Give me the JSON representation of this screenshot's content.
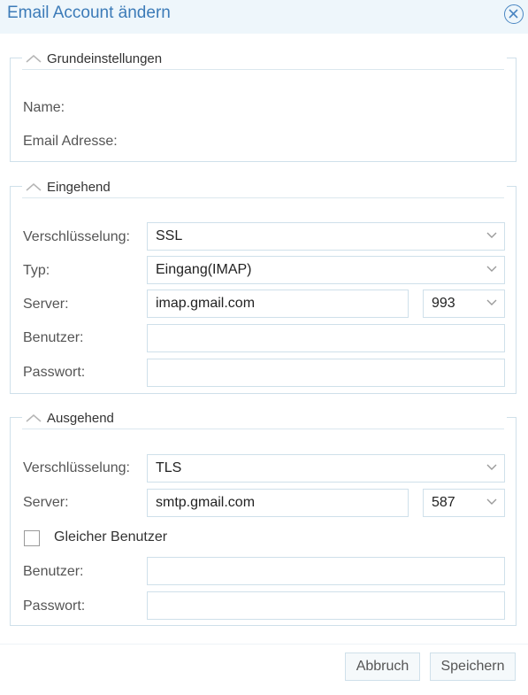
{
  "dialog": {
    "title": "Email Account ändern"
  },
  "basic": {
    "legend": "Grundeinstellungen",
    "name_label": "Name:",
    "email_label": "Email Adresse:"
  },
  "incoming": {
    "legend": "Eingehend",
    "encryption_label": "Verschlüsselung:",
    "encryption_value": "SSL",
    "type_label": "Typ:",
    "type_value": "Eingang(IMAP)",
    "server_label": "Server:",
    "server_value": "imap.gmail.com",
    "port_value": "993",
    "user_label": "Benutzer:",
    "user_value": "",
    "password_label": "Passwort:",
    "password_value": ""
  },
  "outgoing": {
    "legend": "Ausgehend",
    "encryption_label": "Verschlüsselung:",
    "encryption_value": "TLS",
    "server_label": "Server:",
    "server_value": "smtp.gmail.com",
    "port_value": "587",
    "same_user_label": "Gleicher Benutzer",
    "same_user_checked": false,
    "user_label": "Benutzer:",
    "user_value": "",
    "password_label": "Passwort:",
    "password_value": ""
  },
  "footer": {
    "cancel_label": "Abbruch",
    "save_label": "Speichern"
  },
  "colors": {
    "title": "#3c7bb8",
    "titlebar_bg": "#eef6fb",
    "border": "#cfe0ea"
  }
}
